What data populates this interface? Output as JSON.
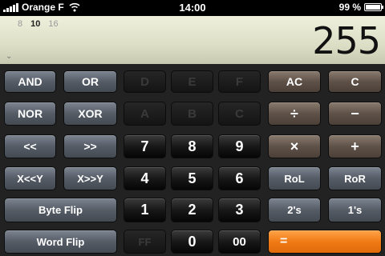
{
  "status_bar": {
    "carrier": "Orange F",
    "time": "14:00",
    "battery": "99 %",
    "battery_level": 0.99
  },
  "display": {
    "bases": [
      "8",
      "10",
      "16"
    ],
    "active_base": "10",
    "value": "255"
  },
  "keys": {
    "and": "AND",
    "or": "OR",
    "d": "D",
    "e": "E",
    "f": "F",
    "ac": "AC",
    "c_clear": "C",
    "nor": "NOR",
    "xor": "XOR",
    "a": "A",
    "b": "B",
    "c": "C",
    "divide": "÷",
    "minus": "−",
    "shl": "<<",
    "shr": ">>",
    "seven": "7",
    "eight": "8",
    "nine": "9",
    "times": "×",
    "plus": "+",
    "xshl": "X<<Y",
    "xshr": "X>>Y",
    "four": "4",
    "five": "5",
    "six": "6",
    "rol": "RoL",
    "ror": "RoR",
    "byte_flip": "Byte Flip",
    "one": "1",
    "two": "2",
    "three": "3",
    "twos": "2's",
    "ones": "1's",
    "word_flip": "Word Flip",
    "ff": "FF",
    "zero": "0",
    "doublezero": "00",
    "equals": "="
  },
  "colors": {
    "accent_orange": "#f07a16",
    "display_bg": "#e4e6cf"
  }
}
